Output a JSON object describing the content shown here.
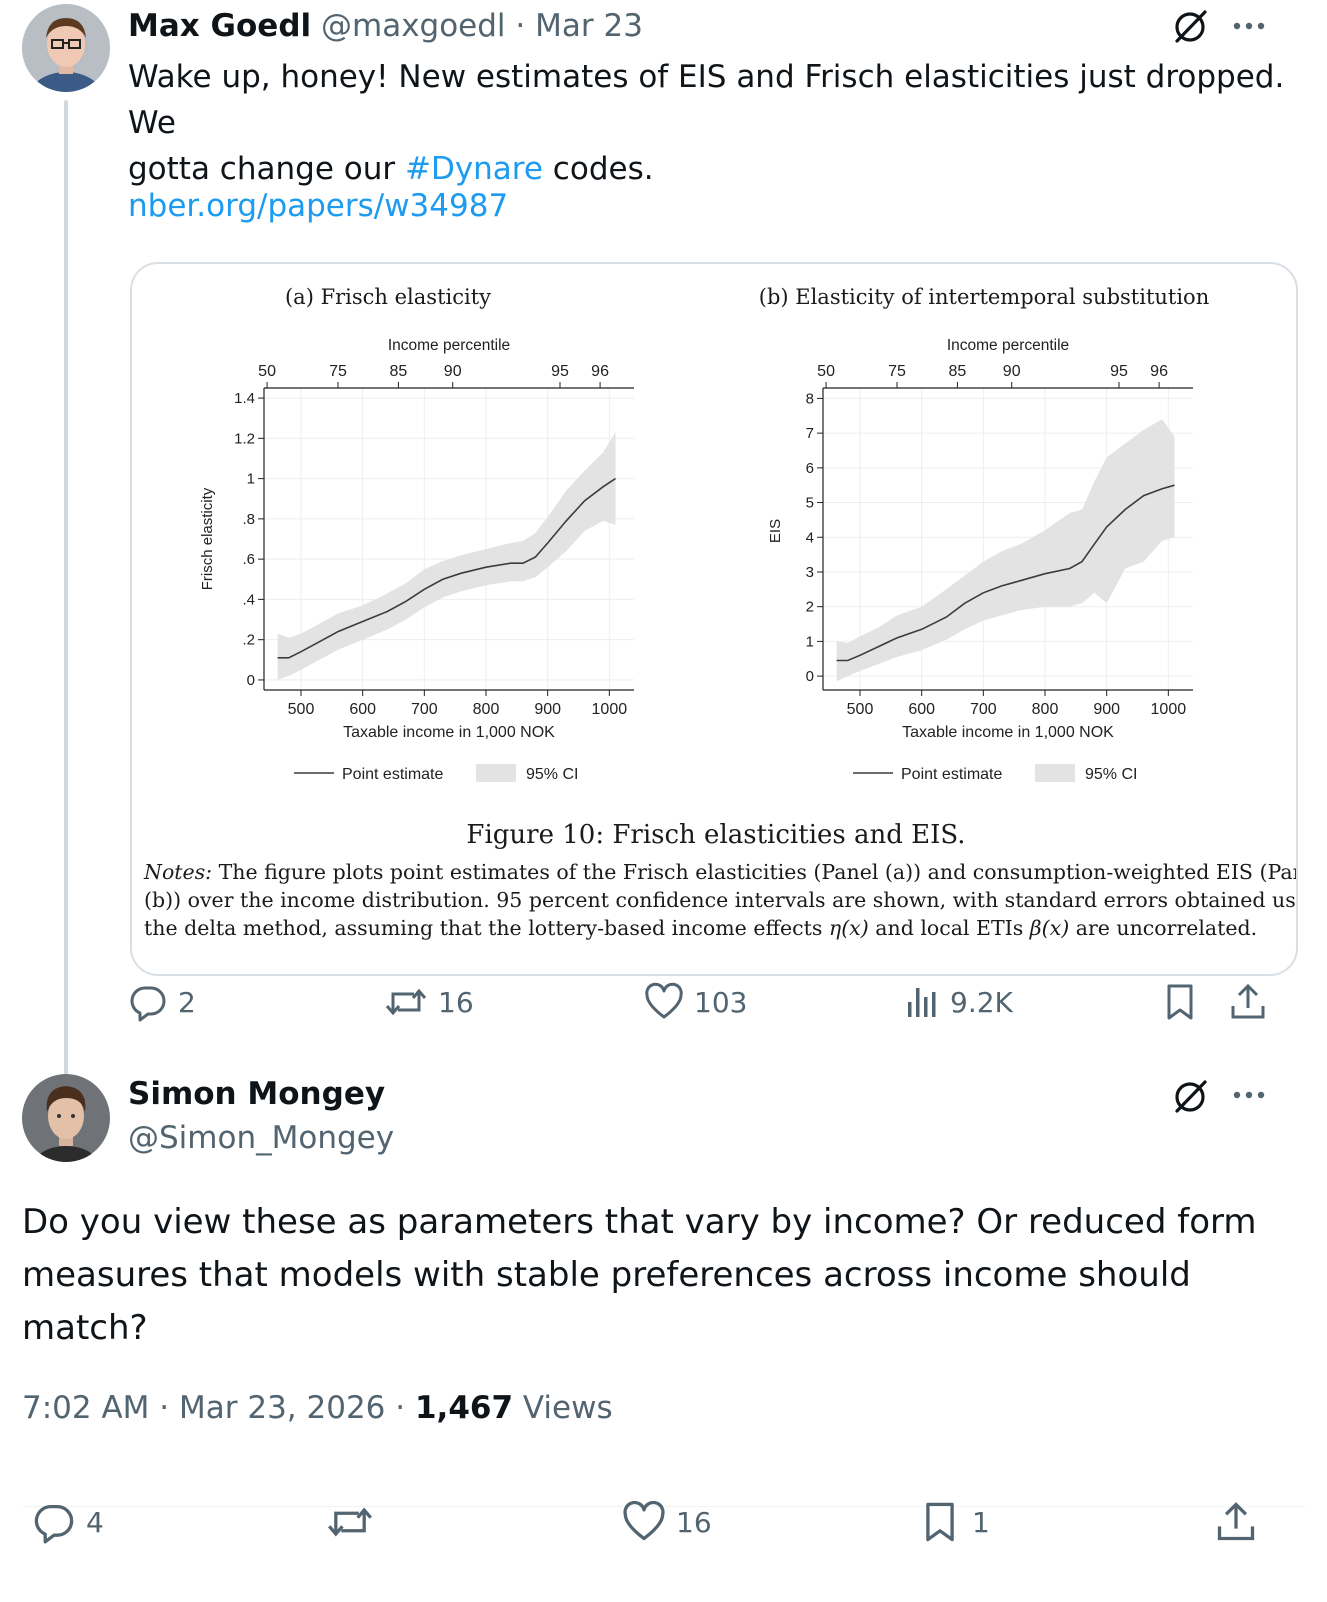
{
  "tweet1": {
    "author_name": "Max Goedl",
    "handle": "@maxgoedl",
    "sep": "·",
    "date": "Mar 23",
    "text_line1": "Wake up, honey! New estimates of EIS and Frisch elasticities just dropped. We",
    "text_line2_pre": "gotta change our ",
    "hashtag": "#Dynare",
    "text_line2_post": " codes.",
    "url": "nber.org/papers/w34987",
    "actions": {
      "replies": "2",
      "reposts": "16",
      "likes": "103",
      "views": "9.2K"
    }
  },
  "figure": {
    "caption": "Figure 10: Frisch elasticities and EIS.",
    "notes_label": "Notes:",
    "notes_line1": " The figure plots point estimates of the Frisch elasticities (Panel (a)) and consumption-weighted EIS (Panel",
    "notes_line2": "(b)) over the income distribution. 95 percent confidence intervals are shown, with standard errors obtained using",
    "notes_line3_a": "the delta method, assuming that the lottery-based income effects ",
    "notes_eta": "η(x)",
    "notes_line3_b": " and local ETIs ",
    "notes_beta": "β(x)",
    "notes_line3_c": " are uncorrelated."
  },
  "chart_data": [
    {
      "type": "line",
      "title": "(a) Frisch elasticity",
      "xlabel": "Taxable income in 1,000 NOK",
      "ylabel": "Frisch elasticity",
      "top_axis_label": "Income percentile",
      "top_ticks": [
        {
          "label": "50",
          "x": 445
        },
        {
          "label": "75",
          "x": 560
        },
        {
          "label": "85",
          "x": 658
        },
        {
          "label": "90",
          "x": 746
        },
        {
          "label": "95",
          "x": 920
        },
        {
          "label": "96",
          "x": 985
        }
      ],
      "xlim": [
        440,
        1040
      ],
      "ylim": [
        -0.05,
        1.45
      ],
      "x_ticks": [
        500,
        600,
        700,
        800,
        900,
        1000
      ],
      "y_ticks": [
        0,
        0.2,
        0.4,
        0.6,
        0.8,
        1,
        1.2,
        1.4
      ],
      "y_tick_labels": [
        "0",
        ".2",
        ".4",
        ".6",
        ".8",
        "1",
        "1.2",
        "1.4"
      ],
      "legend": [
        "Point estimate",
        "95% CI"
      ],
      "legend_position": "bottom",
      "grid": true,
      "series": [
        {
          "name": "Point estimate",
          "x": [
            462,
            480,
            500,
            530,
            560,
            600,
            640,
            670,
            700,
            730,
            760,
            800,
            840,
            860,
            880,
            900,
            930,
            960,
            990,
            1010
          ],
          "y": [
            0.11,
            0.11,
            0.14,
            0.19,
            0.24,
            0.29,
            0.34,
            0.39,
            0.45,
            0.5,
            0.53,
            0.56,
            0.58,
            0.58,
            0.61,
            0.68,
            0.79,
            0.89,
            0.96,
            1.0
          ]
        },
        {
          "name": "95% CI",
          "x": [
            462,
            480,
            500,
            530,
            560,
            600,
            640,
            670,
            700,
            730,
            760,
            800,
            840,
            860,
            880,
            900,
            930,
            960,
            990,
            1010
          ],
          "lower": [
            0.0,
            0.02,
            0.05,
            0.1,
            0.15,
            0.2,
            0.25,
            0.3,
            0.36,
            0.41,
            0.44,
            0.47,
            0.49,
            0.49,
            0.51,
            0.56,
            0.64,
            0.74,
            0.79,
            0.77
          ],
          "upper": [
            0.23,
            0.21,
            0.23,
            0.28,
            0.33,
            0.37,
            0.43,
            0.48,
            0.55,
            0.59,
            0.62,
            0.65,
            0.68,
            0.69,
            0.73,
            0.81,
            0.94,
            1.04,
            1.13,
            1.23
          ]
        }
      ]
    },
    {
      "type": "line",
      "title": "(b) Elasticity of intertemporal substitution",
      "xlabel": "Taxable income in 1,000 NOK",
      "ylabel": "EIS",
      "top_axis_label": "Income percentile",
      "top_ticks": [
        {
          "label": "50",
          "x": 445
        },
        {
          "label": "75",
          "x": 560
        },
        {
          "label": "85",
          "x": 658
        },
        {
          "label": "90",
          "x": 746
        },
        {
          "label": "95",
          "x": 920
        },
        {
          "label": "96",
          "x": 985
        }
      ],
      "xlim": [
        440,
        1040
      ],
      "ylim": [
        -0.4,
        8.3
      ],
      "x_ticks": [
        500,
        600,
        700,
        800,
        900,
        1000
      ],
      "y_ticks": [
        0,
        1,
        2,
        3,
        4,
        5,
        6,
        7,
        8
      ],
      "y_tick_labels": [
        "0",
        "1",
        "2",
        "3",
        "4",
        "5",
        "6",
        "7",
        "8"
      ],
      "legend": [
        "Point estimate",
        "95% CI"
      ],
      "legend_position": "bottom",
      "grid": true,
      "series": [
        {
          "name": "Point estimate",
          "x": [
            462,
            480,
            500,
            530,
            560,
            600,
            640,
            670,
            700,
            730,
            760,
            800,
            840,
            860,
            880,
            900,
            930,
            960,
            990,
            1010
          ],
          "y": [
            0.45,
            0.45,
            0.6,
            0.85,
            1.1,
            1.35,
            1.7,
            2.1,
            2.4,
            2.6,
            2.75,
            2.95,
            3.1,
            3.3,
            3.8,
            4.3,
            4.8,
            5.2,
            5.4,
            5.5
          ]
        },
        {
          "name": "95% CI",
          "x": [
            462,
            480,
            500,
            530,
            560,
            600,
            640,
            670,
            700,
            730,
            760,
            800,
            840,
            860,
            880,
            900,
            930,
            960,
            990,
            1010
          ],
          "lower": [
            -0.15,
            0.0,
            0.15,
            0.35,
            0.55,
            0.75,
            1.05,
            1.35,
            1.6,
            1.75,
            1.9,
            2.0,
            2.0,
            2.1,
            2.4,
            2.1,
            3.1,
            3.3,
            3.9,
            4.0
          ],
          "upper": [
            1.0,
            0.95,
            1.15,
            1.4,
            1.75,
            2.0,
            2.5,
            2.9,
            3.3,
            3.6,
            3.8,
            4.2,
            4.7,
            4.8,
            5.6,
            6.3,
            6.7,
            7.1,
            7.4,
            6.9
          ]
        }
      ]
    }
  ],
  "tweet2": {
    "author_name": "Simon Mongey",
    "handle": "@Simon_Mongey",
    "text_line1": "Do you view these as parameters that vary by income? Or reduced form",
    "text_line2": "measures that models with stable preferences across income should",
    "text_line3": "match?",
    "time": "7:02 AM",
    "sep1": "·",
    "date": "Mar 23, 2026",
    "sep2": "·",
    "views_count": "1,467",
    "views_label": "Views",
    "actions": {
      "replies": "4",
      "likes": "16",
      "bookmarks": "1"
    }
  },
  "colors": {
    "link": "#1d9bf0",
    "muted": "#536471",
    "text": "#0f1419",
    "ci_band": "#e3e3e3",
    "line": "#3c3c3c"
  }
}
